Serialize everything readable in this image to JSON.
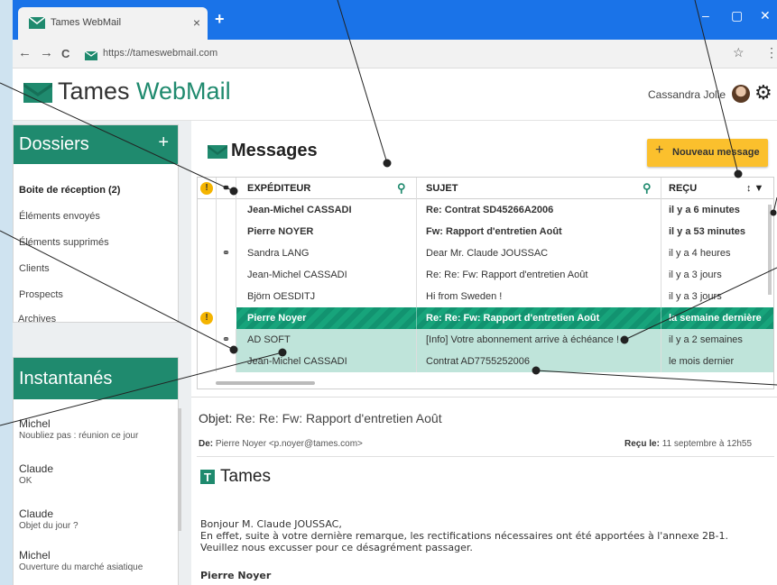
{
  "browser": {
    "tab_title": "Tames WebMail",
    "tab_close": "×",
    "new_tab": "+",
    "url": "https://tameswebmail.com",
    "window_controls": [
      "–",
      "▢",
      "✕"
    ],
    "nav_back": "←",
    "nav_forward": "→",
    "nav_reload": "C",
    "star": "☆",
    "menu": "⋮"
  },
  "header": {
    "logo_part1": "Tames ",
    "logo_part2": "WebMail",
    "user_name": "Cassandra Jolie",
    "settings_icon": "⚙"
  },
  "folders": {
    "title": "Dossiers",
    "add": "+",
    "items": [
      "Boite de réception (2)",
      "Éléments envoyés",
      "Éléments supprimés",
      "Clients",
      "Prospects",
      "Archives"
    ]
  },
  "snapshots": {
    "title": "Instantanés",
    "items": [
      {
        "who": "Michel",
        "what": "Noubliez pas : réunion ce jour"
      },
      {
        "who": "Claude",
        "what": "OK"
      },
      {
        "who": "Claude",
        "what": "Objet du jour ?"
      },
      {
        "who": "Michel",
        "what": "Ouverture du marché asiatique"
      }
    ]
  },
  "messages": {
    "title": "Messages",
    "new_button": "Nouveau message",
    "new_plus": "+",
    "columns": {
      "from": "EXPÉDITEUR",
      "subject": "SUJET",
      "received": "REÇU"
    },
    "sort_icons": "↕ ▼",
    "search_icon": "⚲",
    "rows": [
      {
        "from": "Jean-Michel CASSADI",
        "subject": "Re: Contrat SD45266A2006",
        "received": "il y a 6 minutes"
      },
      {
        "from": "Pierre NOYER",
        "subject": "Fw: Rapport d'entretien Août",
        "received": "il y a 53 minutes"
      },
      {
        "from": "Sandra LANG",
        "subject": "Dear Mr. Claude JOUSSAC",
        "received": "il y a 4 heures"
      },
      {
        "from": "Jean-Michel CASSADI",
        "subject": "Re: Re: Fw: Rapport d'entretien Août",
        "received": "il y a 3 jours"
      },
      {
        "from": "Björn OESDITJ",
        "subject": "Hi from Sweden !",
        "received": "il y a 3 jours"
      },
      {
        "from": "Pierre Noyer",
        "subject": "Re: Re: Fw: Rapport d'entretien Août",
        "received": "la semaine dernière"
      },
      {
        "from": "AD SOFT",
        "subject": "[Info] Votre abonnement arrive à échéance !",
        "received": "il y a 2 semaines"
      },
      {
        "from": "Jean-Michel CASSADI",
        "subject": "Contrat AD7755252006",
        "received": "le mois dernier"
      }
    ],
    "warn_mark": "!",
    "attach_mark": "⚭"
  },
  "preview": {
    "objet_label": "Objet:",
    "objet_value": "Re: Re: Fw: Rapport d'entretien Août",
    "from_label": "De:",
    "from_value": "Pierre Noyer <p.noyer@tames.com>",
    "received_label": "Reçu le:",
    "received_value": "11 septembre à 12h55",
    "company": "Tames",
    "company_mark": "T",
    "greeting": "Bonjour M. Claude JOUSSAC,",
    "line1": "En effet, suite à votre dernière remarque, les rectifications nécessaires ont été apportées à l'annexe 2B-1.",
    "line2": "Veuillez nous excusser pour ce désagrément passager.",
    "signature": "Pierre Noyer"
  },
  "colors": {
    "brand": "#1f8a6e",
    "accent": "#fbc02d",
    "chrome": "#1a73e8",
    "selected": "#17a47b",
    "highlight": "#bfe4da"
  }
}
